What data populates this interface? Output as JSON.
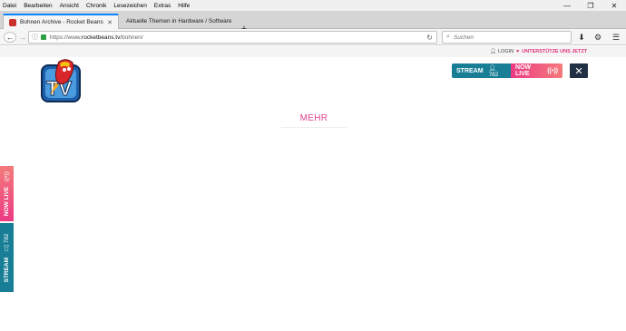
{
  "menubar": [
    "Datei",
    "Bearbeiten",
    "Ansicht",
    "Chronik",
    "Lesezeichen",
    "Extras",
    "Hilfe"
  ],
  "tabs": [
    {
      "label": "Bohnen Archive - Rocket Beans T..."
    },
    {
      "label": "Aktuelle Themen in Hardware / Software - ..."
    }
  ],
  "address": {
    "prefix": "https://www.",
    "domain": "rocketbeans.tv",
    "path": "/bohnen/"
  },
  "search": {
    "placeholder": "Suchen"
  },
  "header": {
    "login": "LOGIN",
    "support": "UNTERSTÜTZE UNS JETZT"
  },
  "stream": {
    "label": "STREAM",
    "count": "782",
    "live_label": "NOW LIVE"
  },
  "main": {
    "more_label": "MEHR"
  },
  "sidebar": {
    "live_label": "NOW LIVE",
    "stream_label": "STREAM",
    "stream_count": "782"
  },
  "colors": {
    "accent_pink": "#e0438e",
    "stream_teal": "#177e96",
    "close_navy": "#223046"
  }
}
